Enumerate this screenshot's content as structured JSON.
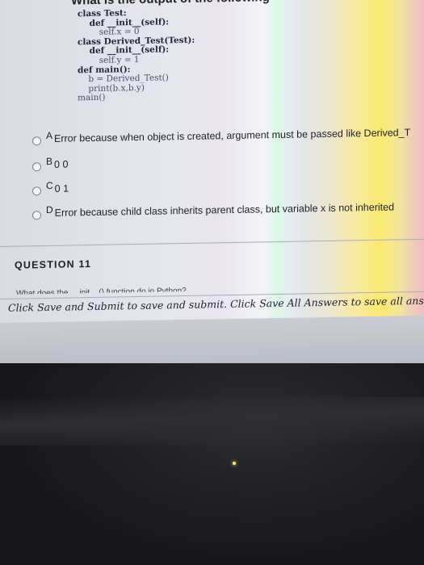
{
  "header": {
    "cut_title": "What is the output of the following"
  },
  "code_lines": [
    "class Test:",
    "    def __init__(self):",
    "        self.x = 0",
    "class Derived_Test(Test):",
    "    def __init__(self):",
    "        self.y = 1",
    "def main():",
    "    b = Derived_Test()",
    "    print(b.x,b.y)",
    "main()"
  ],
  "options": [
    {
      "letter": "A",
      "text": "Error because when object is created, argument must be passed like Derived_T"
    },
    {
      "letter": "B",
      "text": "0 0"
    },
    {
      "letter": "C",
      "text": "0 1"
    },
    {
      "letter": "D",
      "text": "Error because child class inherits parent class, but variable x is not inherited"
    }
  ],
  "next_question": {
    "title": "QUESTION 11",
    "cut_text": "What does the __init__() function do in Python?"
  },
  "footer": {
    "save_text": "Click Save and Submit to save and submit. Click Save All Answers to save all answers."
  }
}
